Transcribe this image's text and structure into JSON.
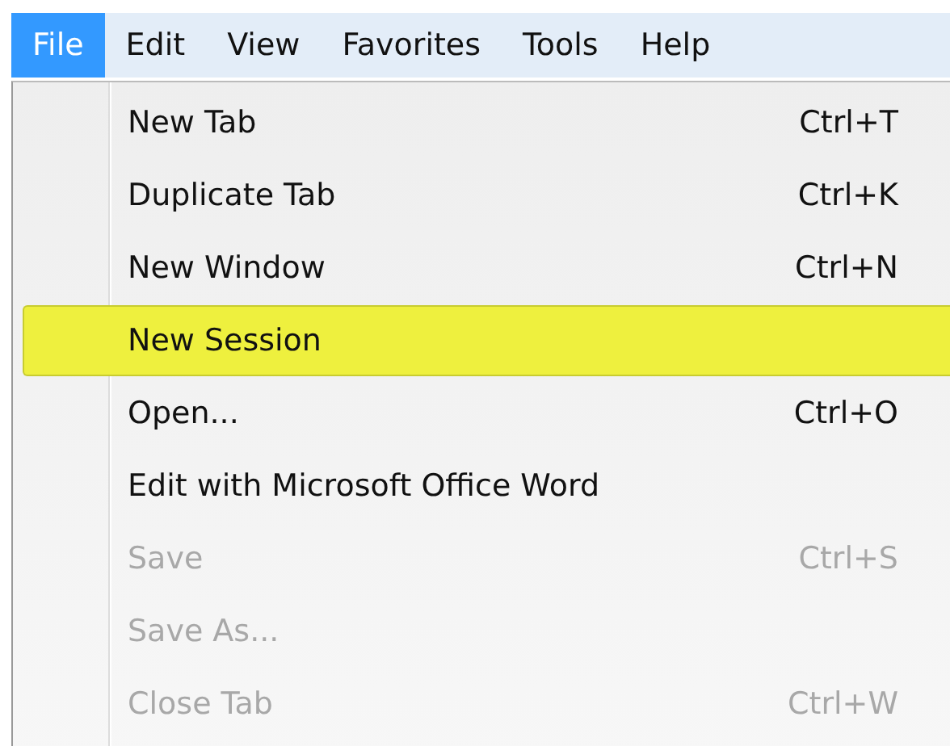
{
  "menubar": [
    {
      "label": "File",
      "selected": true
    },
    {
      "label": "Edit",
      "selected": false
    },
    {
      "label": "View",
      "selected": false
    },
    {
      "label": "Favorites",
      "selected": false
    },
    {
      "label": "Tools",
      "selected": false
    },
    {
      "label": "Help",
      "selected": false
    }
  ],
  "menu": {
    "items": [
      {
        "label": "New Tab",
        "shortcut": "Ctrl+T",
        "disabled": false,
        "selected": false
      },
      {
        "label": "Duplicate Tab",
        "shortcut": "Ctrl+K",
        "disabled": false,
        "selected": false
      },
      {
        "label": "New Window",
        "shortcut": "Ctrl+N",
        "disabled": false,
        "selected": false
      },
      {
        "label": "New Session",
        "disabled": false,
        "selected": true
      },
      {
        "label": "Open...",
        "shortcut": "Ctrl+O",
        "disabled": false,
        "selected": false
      },
      {
        "label": "Edit with Microsoft Office Word",
        "disabled": false,
        "selected": false
      },
      {
        "label": "Save",
        "shortcut": "Ctrl+S",
        "disabled": true,
        "selected": false
      },
      {
        "label": "Save As...",
        "disabled": true,
        "selected": false
      },
      {
        "label": "Close Tab",
        "shortcut": "Ctrl+W",
        "disabled": true,
        "selected": false
      }
    ]
  }
}
